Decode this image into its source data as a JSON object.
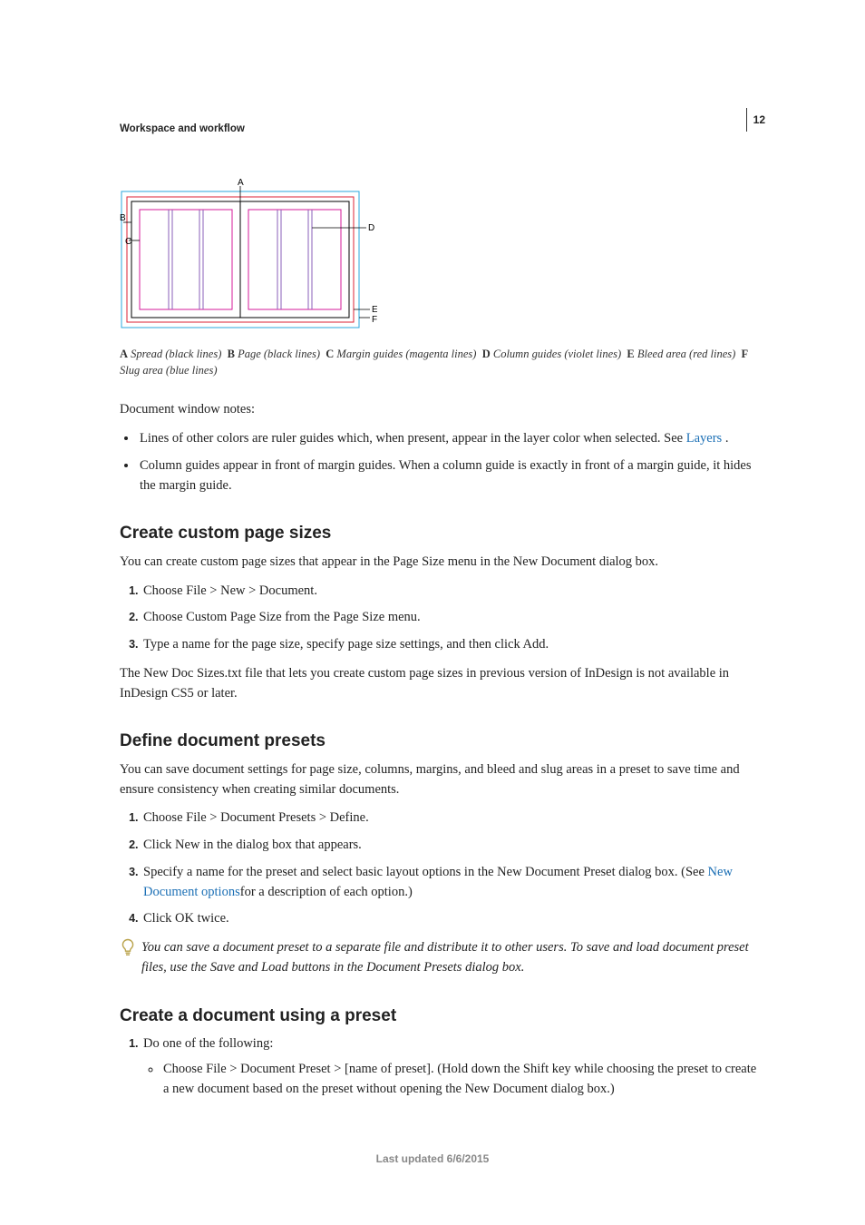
{
  "page_number": "12",
  "running_head": "Workspace and workflow",
  "diagram": {
    "labels": {
      "A": "A",
      "B": "B",
      "C": "C",
      "D": "D",
      "E": "E",
      "F": "F"
    }
  },
  "caption": {
    "parts": [
      {
        "label": "A",
        "text": "Spread (black lines)"
      },
      {
        "label": "B",
        "text": "Page (black lines)"
      },
      {
        "label": "C",
        "text": "Margin guides (magenta lines)"
      },
      {
        "label": "D",
        "text": "Column guides (violet lines)"
      },
      {
        "label": "E",
        "text": "Bleed area (red lines)"
      },
      {
        "label": "F",
        "text": "Slug area (blue lines)"
      }
    ]
  },
  "doc_notes_intro": "Document window notes:",
  "notes": {
    "0_pre": "Lines of other colors are ruler guides which, when present, appear in the layer color when selected. See ",
    "0_link": "Layers ",
    "0_post": ".",
    "1": "Column guides appear in front of margin guides. When a column guide is exactly in front of a margin guide, it hides the margin guide."
  },
  "s1": {
    "heading": "Create custom page sizes",
    "intro": "You can create custom page sizes that appear in the Page Size menu in the New Document dialog box.",
    "steps": [
      "Choose File > New > Document.",
      "Choose Custom Page Size from the Page Size menu.",
      "Type a name for the page size, specify page size settings, and then click Add."
    ],
    "outro": "The New Doc Sizes.txt file that lets you create custom page sizes in previous version of InDesign is not available in InDesign CS5 or later."
  },
  "s2": {
    "heading": "Define document presets",
    "intro": "You can save document settings for page size, columns, margins, and bleed and slug areas in a preset to save time and ensure consistency when creating similar documents.",
    "steps": {
      "0": "Choose File > Document Presets > Define.",
      "1": "Click New in the dialog box that appears.",
      "2_pre": "Specify a name for the preset and select basic layout options in the New Document Preset dialog box. (See ",
      "2_link": "New Document options",
      "2_post": "for a description of each option.)",
      "3": "Click OK twice."
    },
    "tip": "You can save a document preset to a separate file and distribute it to other users. To save and load document preset files, use the Save and Load buttons in the Document Presets dialog box."
  },
  "s3": {
    "heading": "Create a document using a preset",
    "step1": "Do one of the following:",
    "sub1": "Choose File > Document Preset > [name of preset]. (Hold down the Shift key while choosing the preset to create a new document based on the preset without opening the New Document dialog box.)"
  },
  "footer": "Last updated 6/6/2015"
}
